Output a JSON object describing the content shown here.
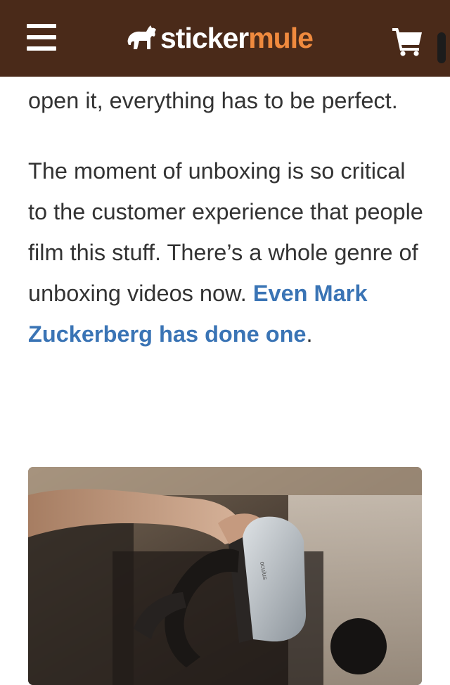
{
  "header": {
    "logo_part1": "sticker",
    "logo_part2": "mule",
    "menu_icon": "hamburger-menu-icon",
    "cart_icon": "shopping-cart-icon",
    "logo_icon": "mule-icon",
    "background_color": "#4a2a19",
    "accent_color": "#f08a3e"
  },
  "article": {
    "paragraph1": "open it, everything has to be perfect.",
    "paragraph2_text": "The moment of unboxing is so critical to the customer experience that people film this stuff. There’s a whole genre of unboxing videos now. ",
    "paragraph2_link": "Even Mark Zuckerberg has done one",
    "paragraph2_end": ".",
    "link_color": "#3a74b5",
    "headset_label": "oculus"
  }
}
